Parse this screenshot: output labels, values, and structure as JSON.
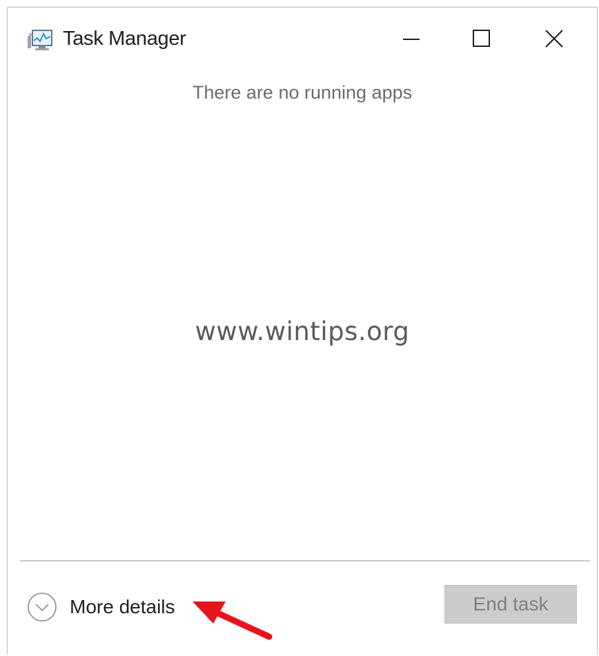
{
  "window": {
    "title": "Task Manager",
    "app_icon": "task-manager-icon"
  },
  "titlebar_buttons": {
    "minimize_icon": "minimize-icon",
    "maximize_icon": "maximize-icon",
    "close_icon": "close-icon"
  },
  "main": {
    "empty_message": "There are no running apps",
    "watermark": "www.wintips.org"
  },
  "footer": {
    "more_details_label": "More details",
    "more_details_icon": "chevron-down-circle-icon",
    "end_task_label": "End task",
    "end_task_enabled": false
  },
  "annotation": {
    "arrow_color": "#e8141c"
  },
  "colors": {
    "disabled_button_bg": "#cccccc",
    "disabled_button_text": "#7f7f7f",
    "message_text": "#6b6b6b"
  }
}
